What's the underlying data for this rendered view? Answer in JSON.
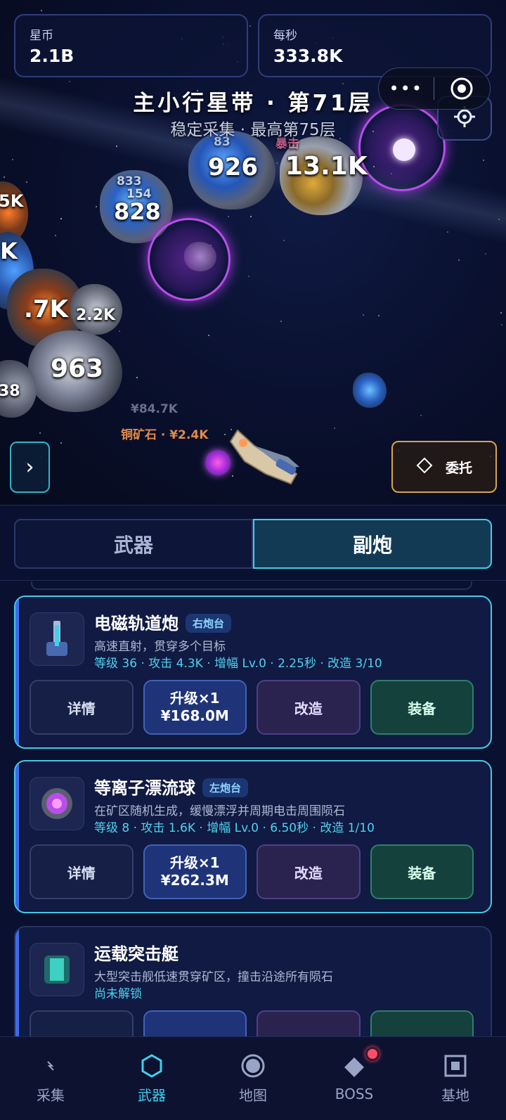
{
  "stats": {
    "coins_label": "星币",
    "coins_value": "2.1B",
    "rate_label": "每秒",
    "rate_value": "333.8K"
  },
  "level": {
    "title": "主小行星带 · 第71层",
    "subtitle": "稳定采集 · 最高第75层"
  },
  "capsule": {
    "more_icon": "more-dots-icon",
    "target_icon": "target-icon"
  },
  "damage_numbers": [
    "926",
    "13.1K",
    "828",
    "5K",
    "K",
    ".7K",
    "2.2K",
    "963",
    "38",
    "833",
    "154",
    "83"
  ],
  "crit_text": "暴击",
  "loot": {
    "faded": "¥84.7K",
    "copper": "铜矿石 · ¥2.4K"
  },
  "commission_label": "委托",
  "side_arrow_label": "›",
  "tabs": {
    "weapons": "武器",
    "secondary": "副炮"
  },
  "cards": [
    {
      "name": "电磁轨道炮",
      "badge": "右炮台",
      "desc": "高速直射，贯穿多个目标",
      "stats": "等级 36 · 攻击 4.3K · 增幅 Lv.0 · 2.25秒 · 改造 3/10",
      "detail": "详情",
      "upgrade_line1": "升级×1",
      "upgrade_line2": "¥168.0M",
      "modify": "改造",
      "equip": "装备"
    },
    {
      "name": "等离子漂流球",
      "badge": "左炮台",
      "desc": "在矿区随机生成，缓慢漂浮并周期电击周围陨石",
      "stats": "等级 8 · 攻击 1.6K · 增幅 Lv.0 · 6.50秒 · 改造 1/10",
      "detail": "详情",
      "upgrade_line1": "升级×1",
      "upgrade_line2": "¥262.3M",
      "modify": "改造",
      "equip": "装备"
    },
    {
      "name": "运载突击艇",
      "desc": "大型突击舰低速贯穿矿区，撞击沿途所有陨石",
      "stats": "尚未解锁"
    }
  ],
  "nav": [
    {
      "label": "采集",
      "icon": "lightning-icon"
    },
    {
      "label": "武器",
      "icon": "hexagon-icon"
    },
    {
      "label": "地图",
      "icon": "planet-icon"
    },
    {
      "label": "BOSS",
      "icon": "diamond-icon"
    },
    {
      "label": "基地",
      "icon": "square-icon"
    }
  ],
  "colors": {
    "accent": "#3ed0ee",
    "background": "#0a1130",
    "badge": "#ff4d6b"
  }
}
